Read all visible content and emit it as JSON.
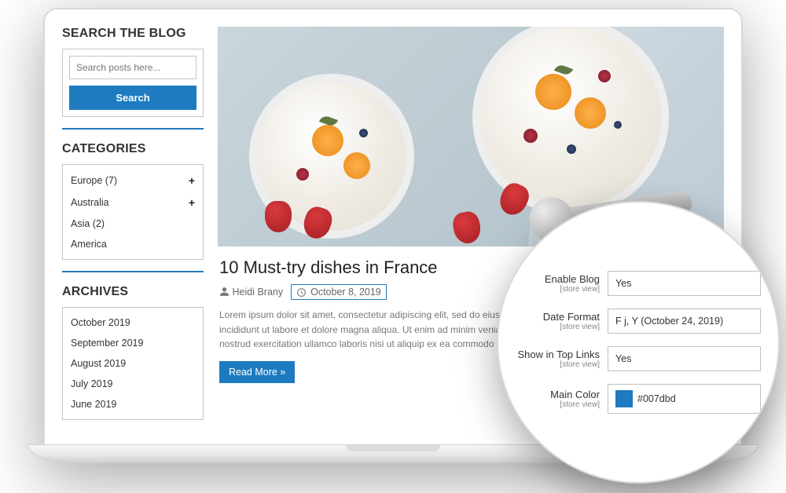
{
  "sidebar": {
    "search": {
      "title": "SEARCH THE BLOG",
      "placeholder": "Search posts here...",
      "button": "Search"
    },
    "categories": {
      "title": "CATEGORIES",
      "items": [
        {
          "label": "Europe (7)",
          "expandable": true
        },
        {
          "label": "Australia",
          "expandable": true
        },
        {
          "label": "Asia (2)",
          "expandable": false
        },
        {
          "label": "America",
          "expandable": false
        }
      ]
    },
    "archives": {
      "title": "ARCHIVES",
      "items": [
        "October 2019",
        "September 2019",
        "August 2019",
        "July 2019",
        "June 2019"
      ]
    }
  },
  "post": {
    "title": "10 Must-try dishes in France",
    "author": "Heidi Brany",
    "date": "October 8, 2019",
    "excerpt": "Lorem ipsum dolor sit amet, consectetur adipiscing elit, sed do eiusmod tempor incididunt ut labore et dolore magna aliqua. Ut enim ad minim veniam, quis nostrud exercitation ullamco laboris nisi ut aliquip ex ea commodo consequat.",
    "read_more": "Read More »"
  },
  "settings": {
    "scope": "[store view]",
    "rows": [
      {
        "label": "Enable Blog",
        "value": "Yes"
      },
      {
        "label": "Date Format",
        "value": "F j, Y (October 24, 2019)"
      },
      {
        "label": "Show in Top Links",
        "value": "Yes"
      },
      {
        "label": "Main Color",
        "value": "#007dbd"
      }
    ]
  }
}
